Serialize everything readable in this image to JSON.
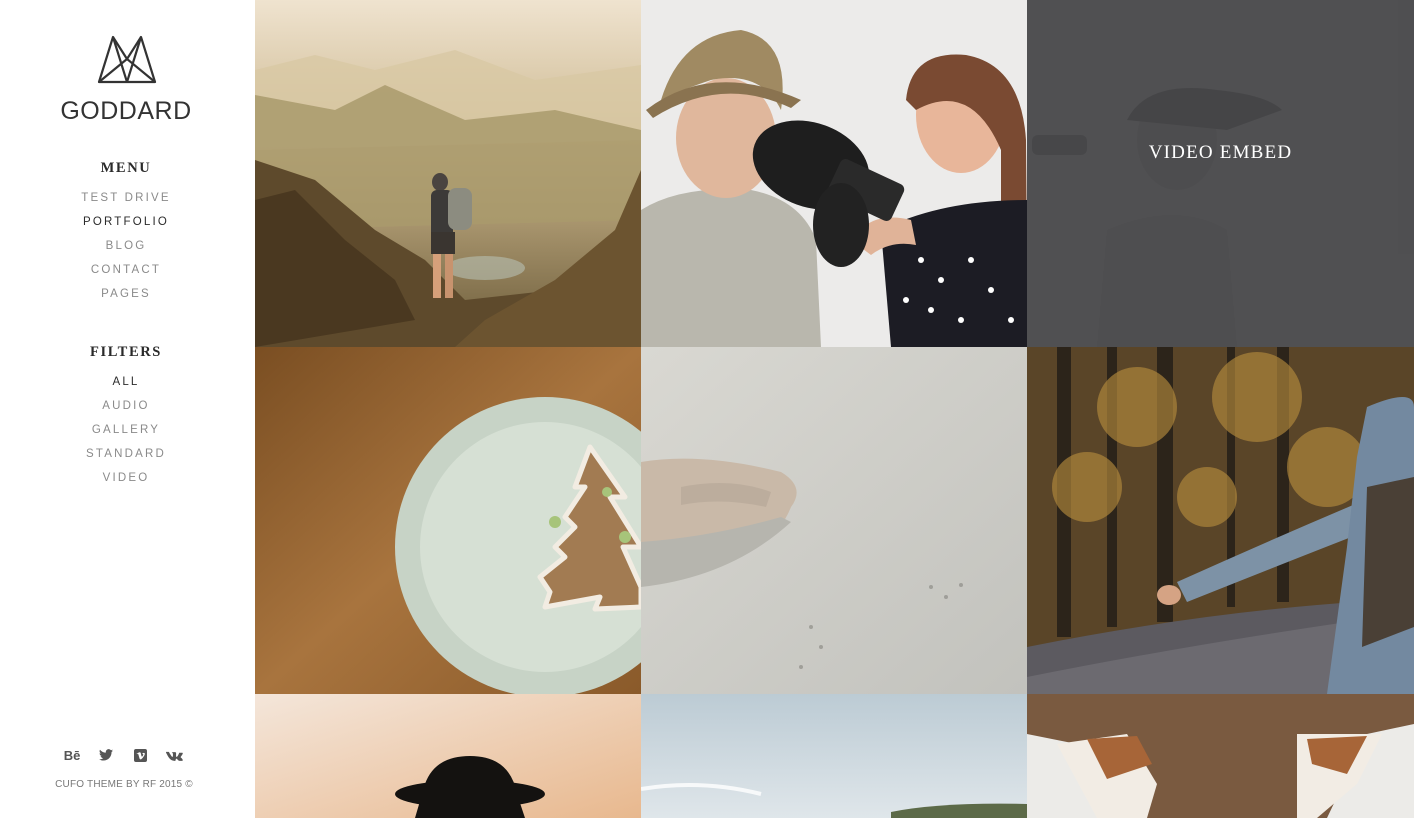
{
  "brand": {
    "name": "GODDARD",
    "logo_icon": "mountain-triangle-logo"
  },
  "menu": {
    "title": "MENU",
    "items": [
      {
        "label": "TEST DRIVE",
        "active": false
      },
      {
        "label": "PORTFOLIO",
        "active": true
      },
      {
        "label": "BLOG",
        "active": false
      },
      {
        "label": "CONTACT",
        "active": false
      },
      {
        "label": "PAGES",
        "active": false
      }
    ]
  },
  "filters": {
    "title": "FILTERS",
    "items": [
      {
        "label": "ALL",
        "active": true
      },
      {
        "label": "AUDIO",
        "active": false
      },
      {
        "label": "GALLERY",
        "active": false
      },
      {
        "label": "STANDARD",
        "active": false
      },
      {
        "label": "VIDEO",
        "active": false
      }
    ]
  },
  "social": {
    "icons": [
      "behance-icon",
      "twitter-icon",
      "vimeo-icon",
      "vk-icon"
    ],
    "behance_text": "Bē"
  },
  "footer": {
    "copyright": "CUFO THEME BY RF 2015 ©"
  },
  "portfolio": {
    "tiles": [
      {
        "subject": "hiker-on-mountain"
      },
      {
        "subject": "boxing-couple"
      },
      {
        "subject": "video-embed",
        "overlay_label": "VIDEO EMBED"
      },
      {
        "subject": "gingerbread-tree-cookie-on-plate"
      },
      {
        "subject": "hand-in-sand"
      },
      {
        "subject": "hitchhiker-on-forest-road"
      },
      {
        "subject": "silhouette-with-hat-at-sunset"
      },
      {
        "subject": "sea-and-island"
      },
      {
        "subject": "fox-ears"
      }
    ]
  },
  "colors": {
    "accent_text": "#2b2b2b",
    "muted_text": "#8a8a8a",
    "overlay": "#444446"
  }
}
